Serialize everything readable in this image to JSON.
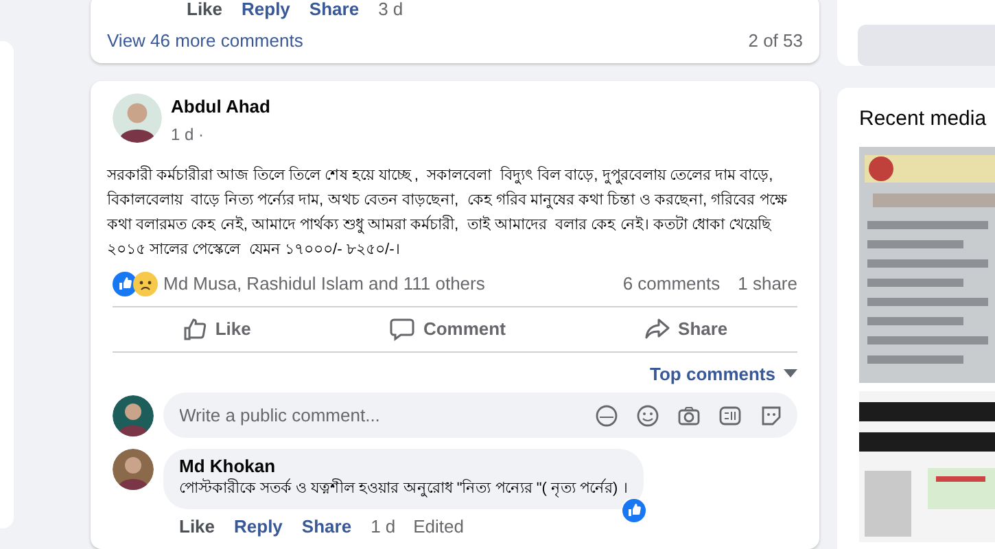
{
  "previous_post": {
    "comment_actions": [
      {
        "kind": "like",
        "label": "Like"
      },
      {
        "kind": "reply",
        "label": "Reply"
      },
      {
        "kind": "share",
        "label": "Share"
      }
    ],
    "comment_time": "3 d",
    "view_more": "View 46 more comments",
    "comment_count": "2 of 53"
  },
  "post": {
    "author": "Abdul Ahad",
    "time": "1 d ·",
    "text": "সরকারী কর্মচারীরা আজ তিলে তিলে শেষ হয়ে যাচ্ছে ,  সকালবেলা  বিদ্যুৎ বিল বাড়ে, দুপুরবেলায় তেলের দাম বাড়ে, বিকালবেলায়  বাড়ে নিত্য পর্ন্যের দাম, অথচ বেতন বাড়ছেনা,  কেহ গরিব মানুষের কথা চিন্তা ও করছেনা, গরিবের পক্ষে কথা বলারমত কেহ নেই, আমাদে পার্থক্য শুধু আমরা কর্মচারী,  তাই আমাদের  বলার কেহ নেই। কতটা ধোকা খেয়েছি ২০১৫ সালের পেস্কেলে  যেমন ১৭০০০/- ৮২৫০/-।",
    "reactions": [
      {
        "kind": "like"
      },
      {
        "kind": "sad"
      }
    ],
    "reactions_text": "Md Musa, Rashidul Islam and 111 others",
    "comments_count": "6 comments",
    "shares_count": "1 share",
    "actions": [
      {
        "kind": "like",
        "label": "Like"
      },
      {
        "kind": "comment",
        "label": "Comment"
      },
      {
        "kind": "share",
        "label": "Share"
      }
    ],
    "sort": "Top comments",
    "comment_placeholder": "Write a public comment...",
    "comments": [
      {
        "author": "Md Khokan",
        "text": "পোস্টকারীকে সতর্ক ও যত্নশীল হওয়ার অনুরোধ \"নিত্য পন্যের \"( নৃত্য পর্নের) ।",
        "actions": [
          {
            "kind": "like",
            "label": "Like"
          },
          {
            "kind": "reply",
            "label": "Reply"
          },
          {
            "kind": "share",
            "label": "Share"
          }
        ],
        "time": "1 d",
        "edited": "Edited",
        "liked": true
      }
    ]
  },
  "sidebar": {
    "title": "Recent media"
  }
}
